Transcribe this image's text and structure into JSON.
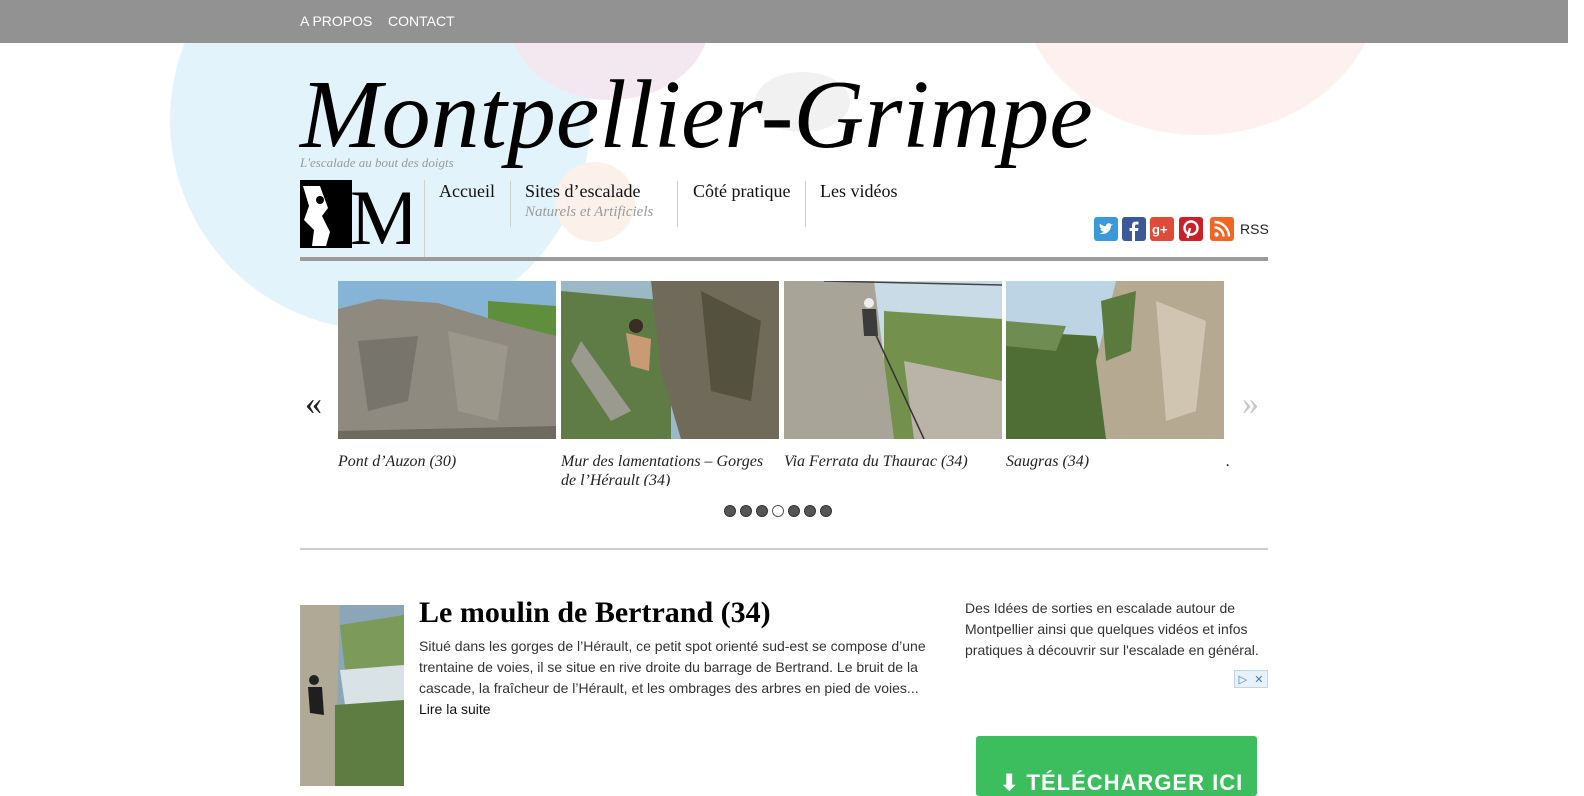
{
  "topnav": {
    "items": [
      "A PROPOS",
      "CONTACT"
    ]
  },
  "site": {
    "title": "Montpellier-Grimpe",
    "tagline": "L'escalade au bout des doigts",
    "logo_letter": "M"
  },
  "mainnav": [
    {
      "label": "Accueil"
    },
    {
      "label": "Sites d’escalade",
      "sublabel": "Naturels et Artificiels"
    },
    {
      "label": "Côté pratique"
    },
    {
      "label": "Les vidéos"
    }
  ],
  "social": {
    "icons": [
      "twitter-icon",
      "facebook-icon",
      "google-plus-icon",
      "pinterest-icon",
      "rss-icon"
    ],
    "colors": [
      "#3a9ad9",
      "#3b5998",
      "#dd4b39",
      "#cb2027",
      "#f26522"
    ],
    "rss_label": "RSS"
  },
  "carousel": {
    "prev": "«",
    "next": "»",
    "slides": [
      {
        "caption": "Pont d’Auzon (30)"
      },
      {
        "caption": "Mur des lamentations – Gorges de l’Hérault (34)"
      },
      {
        "caption": "Via Ferrata du Thaurac (34)"
      },
      {
        "caption": "Saugras (34)"
      }
    ],
    "partial_caption": ".",
    "dots_total": 7,
    "active_dot": 4
  },
  "post": {
    "title": "Le moulin de Bertrand (34)",
    "excerpt": "Situé dans les gorges de l’Hérault, ce petit spot orienté sud-est se compose d’une trentaine de voies, il se situe en rive droite du barrage de Bertrand. Le bruit de la cascade, la fraîcheur de l’Hérault, et les ombrages des arbres en pied de voies...",
    "read_more": "Lire la suite"
  },
  "sidebar": {
    "intro": "Des Idées de sorties en escalade autour de Montpellier ainsi que quelques vidéos et infos pratiques à découvrir sur l'escalade en général.",
    "ad_button": "⬇ TÉLÉCHARGER ICI"
  }
}
